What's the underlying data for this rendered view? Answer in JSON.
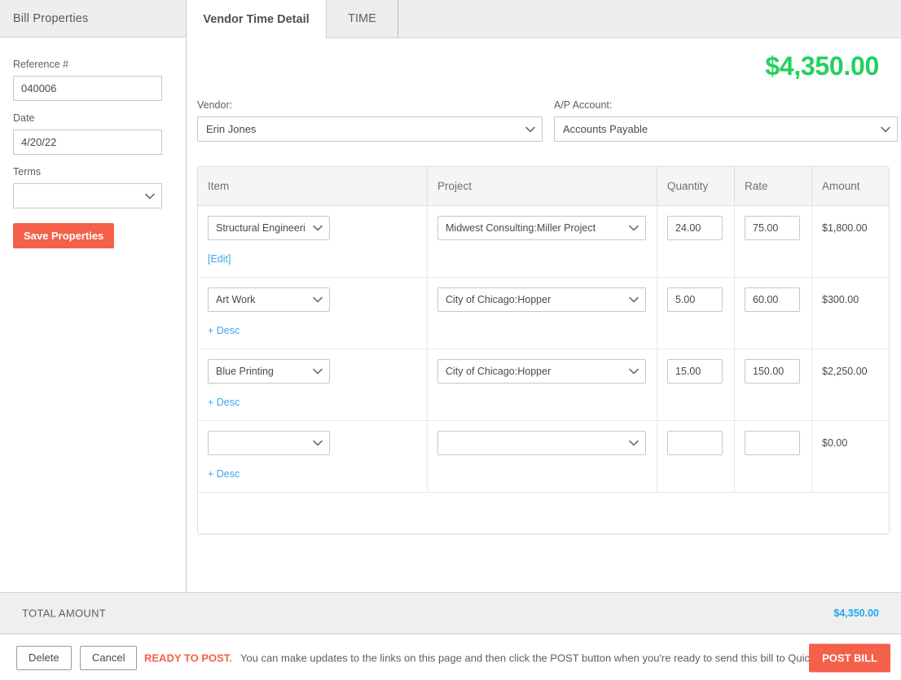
{
  "sidebar": {
    "title": "Bill Properties",
    "reference_label": "Reference #",
    "reference_value": "040006",
    "date_label": "Date",
    "date_value": "4/20/22",
    "terms_label": "Terms",
    "terms_value": "",
    "save_button": "Save Properties"
  },
  "tabs": [
    {
      "label": "Vendor Time Detail",
      "active": true
    },
    {
      "label": "TIME",
      "active": false
    }
  ],
  "header": {
    "grand_total": "$4,350.00",
    "grand_total_color": "#21d25c"
  },
  "selectors": {
    "vendor_label": "Vendor:",
    "vendor_value": "Erin Jones",
    "ap_account_label": "A/P Account:",
    "ap_account_value": "Accounts Payable"
  },
  "table": {
    "columns": [
      "Item",
      "Project",
      "Quantity",
      "Rate",
      "Amount"
    ],
    "rows": [
      {
        "item": "Structural Engineeri",
        "project": "Midwest Consulting:Miller Project",
        "quantity": "24.00",
        "rate": "75.00",
        "amount": "$1,800.00",
        "sub_link": "[Edit]"
      },
      {
        "item": "Art Work",
        "project": "City of Chicago:Hopper",
        "quantity": "5.00",
        "rate": "60.00",
        "amount": "$300.00",
        "sub_link": "+ Desc"
      },
      {
        "item": "Blue Printing",
        "project": "City of Chicago:Hopper",
        "quantity": "15.00",
        "rate": "150.00",
        "amount": "$2,250.00",
        "sub_link": "+ Desc"
      },
      {
        "item": "",
        "project": "",
        "quantity": "",
        "rate": "",
        "amount": "$0.00",
        "sub_link": "+ Desc"
      }
    ]
  },
  "total_bar": {
    "label": "TOTAL AMOUNT",
    "value": "$4,350.00",
    "value_color": "#1aabef"
  },
  "actions": {
    "delete_label": "Delete",
    "cancel_label": "Cancel",
    "status_strong": "READY TO POST.",
    "status_note": "You can make updates to the links on this page and then click the POST button when you're ready to send this bill to QuickBooks.",
    "post_label": "POST BILL",
    "accent_color": "#f4604a"
  },
  "icons": {
    "chevron": "chevron-down-icon"
  }
}
